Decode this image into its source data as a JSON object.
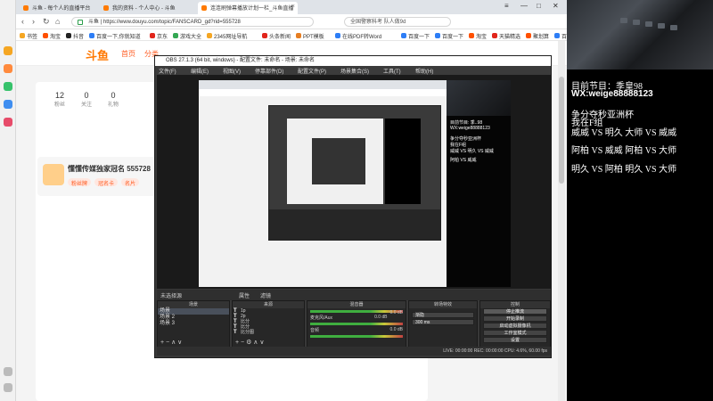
{
  "browser": {
    "tabs": [
      {
        "label": "斗鱼 - 每个人的直播平台",
        "color": "#ff7a00",
        "active": false
      },
      {
        "label": "我的资料 - 个人中心 - 斗鱼",
        "color": "#ff7a00",
        "active": false
      },
      {
        "label": "连连刷弹幕播放计划一栏_斗鱼直播",
        "color": "#ff7a00",
        "active": true
      }
    ],
    "window_controls": [
      "≡",
      "—",
      "□",
      "✕"
    ],
    "secure_label": "斗鱼",
    "url": "https://www.douyu.com/topic/FANSCARD_gd?rid=555728",
    "search_placeholder": "全国警察科考 队人做9d",
    "bookmarks": [
      {
        "label": "书签",
        "color": "#f5a623"
      },
      {
        "label": "淘宝",
        "color": "#ff5000"
      },
      {
        "label": "抖音",
        "color": "#222222"
      },
      {
        "label": "百度一下,你就知道",
        "color": "#2d7df6"
      },
      {
        "label": "京东",
        "color": "#e1251b"
      },
      {
        "label": "游戏大全",
        "color": "#34a853"
      },
      {
        "label": "2345网址导航",
        "color": "#f5a623"
      },
      {
        "label": "头条新闻",
        "color": "#e1251b"
      },
      {
        "label": "PPT模板",
        "color": "#e67e22"
      },
      {
        "label": "在线PDF转Word",
        "color": "#2d7df6"
      },
      {
        "label": "百度一下",
        "color": "#2d7df6"
      },
      {
        "label": "百度一下",
        "color": "#2d7df6"
      },
      {
        "label": "淘宝",
        "color": "#ff5000"
      },
      {
        "label": "天猫精选",
        "color": "#e1251b"
      },
      {
        "label": "聚划算",
        "color": "#ff5000"
      },
      {
        "label": "百度一下",
        "color": "#2d7df6"
      },
      {
        "label": "天猫超市",
        "color": "#e1251b"
      },
      {
        "label": "阿里巴巴",
        "color": "#ff6a00"
      },
      {
        "label": "爱奇艺",
        "color": "#34a853"
      }
    ]
  },
  "douyu": {
    "logo": "斗鱼",
    "nav": [
      "首页",
      "分类"
    ],
    "stats": [
      {
        "value": "12",
        "label": "粉丝"
      },
      {
        "value": "0",
        "label": "关注"
      },
      {
        "value": "0",
        "label": "礼物"
      }
    ],
    "fancard_title": "懂懂传媒独家冠名 555728",
    "chips": [
      "粉丝牌",
      "冠名卡",
      "名片"
    ]
  },
  "obs": {
    "title": "OBS 27.1.3 (64 bit, windows) - 配置文件: 未命名 - 场景: 未命名",
    "menu": [
      "文件(F)",
      "编辑(E)",
      "视图(V)",
      "停靠部件(D)",
      "配置文件(P)",
      "场景集合(S)",
      "工具(T)",
      "帮助(H)"
    ],
    "scene_tabs": [
      "未选择源",
      "属性",
      "滤镜"
    ],
    "panels": {
      "scenes": "场景",
      "sources": "来源",
      "mixer": "混音器",
      "transitions": "转场特效",
      "controls": "控制"
    },
    "scenes": [
      "场景",
      "场景 2",
      "场景 3"
    ],
    "sources": [
      "1p",
      "2p",
      "比分",
      "比分",
      "比分图"
    ],
    "mixer": [
      {
        "label": "",
        "level": "0.0 dB"
      },
      {
        "label": "麦克风/Aux",
        "level": "0.0 dB"
      },
      {
        "label": "音频",
        "level": "0.0 dB"
      }
    ],
    "transition": "渐隐",
    "duration": "300 ms",
    "controls": [
      "停止推流",
      "开始录制",
      "启动虚拟摄像机",
      "工作室模式",
      "设置",
      "退出"
    ],
    "status": "LIVE: 00:00:00   REC: 00:00:00   CPU: 4.6%, 60.00 fps",
    "mirror_lines": [
      "目前节目: 季..98",
      "WX:weige88888123",
      "争分夺秒亚洲杯",
      "我在F组",
      "威威 VS 明久 VS 威威",
      "阿柏 VS 威威"
    ]
  },
  "overlay": {
    "program": "目前节目：季皇98",
    "wx": "WX:weige88888123",
    "event": "争分夺秒亚洲杯",
    "group": "我在F组",
    "matches": [
      "威威 VS 明久 大师 VS 威威",
      "阿柏 VS 威威 阿柏 VS 大师",
      "明久 VS 阿柏 明久 VS 大师"
    ]
  },
  "colors": {
    "douyu_orange": "#ff7800",
    "obs_background": "#383838",
    "overlay_background": "#000000"
  }
}
